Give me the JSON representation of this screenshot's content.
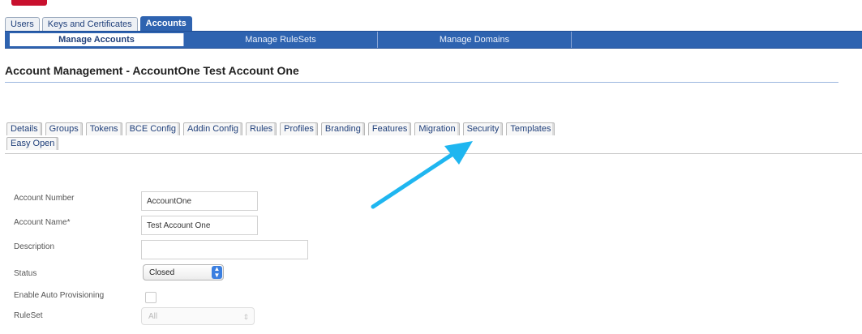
{
  "top_tabs": [
    {
      "label": "Users",
      "active": false
    },
    {
      "label": "Keys and Certificates",
      "active": false
    },
    {
      "label": "Accounts",
      "active": true
    }
  ],
  "nav_bar": [
    {
      "label": "Manage Accounts",
      "active": true
    },
    {
      "label": "Manage RuleSets",
      "active": false
    },
    {
      "label": "Manage Domains",
      "active": false
    }
  ],
  "page_title": "Account Management - AccountOne Test Account One",
  "account_tabs_row1": [
    "Details",
    "Groups",
    "Tokens",
    "BCE Config",
    "Addin Config",
    "Rules",
    "Profiles",
    "Branding",
    "Features",
    "Migration",
    "Security",
    "Templates"
  ],
  "account_tabs_row2": [
    "Easy Open"
  ],
  "form": {
    "account_number": {
      "label": "Account Number",
      "value": "AccountOne"
    },
    "account_name": {
      "label": "Account Name*",
      "value": "Test Account One"
    },
    "description": {
      "label": "Description",
      "value": ""
    },
    "status": {
      "label": "Status",
      "value": "Closed"
    },
    "auto_provisioning": {
      "label": "Enable Auto Provisioning",
      "checked": false
    },
    "ruleset": {
      "label": "RuleSet",
      "value": "All"
    }
  },
  "colors": {
    "accent": "#2e63b0",
    "annotation_arrow": "#1fb6f0",
    "brand_red": "#c8102e"
  }
}
